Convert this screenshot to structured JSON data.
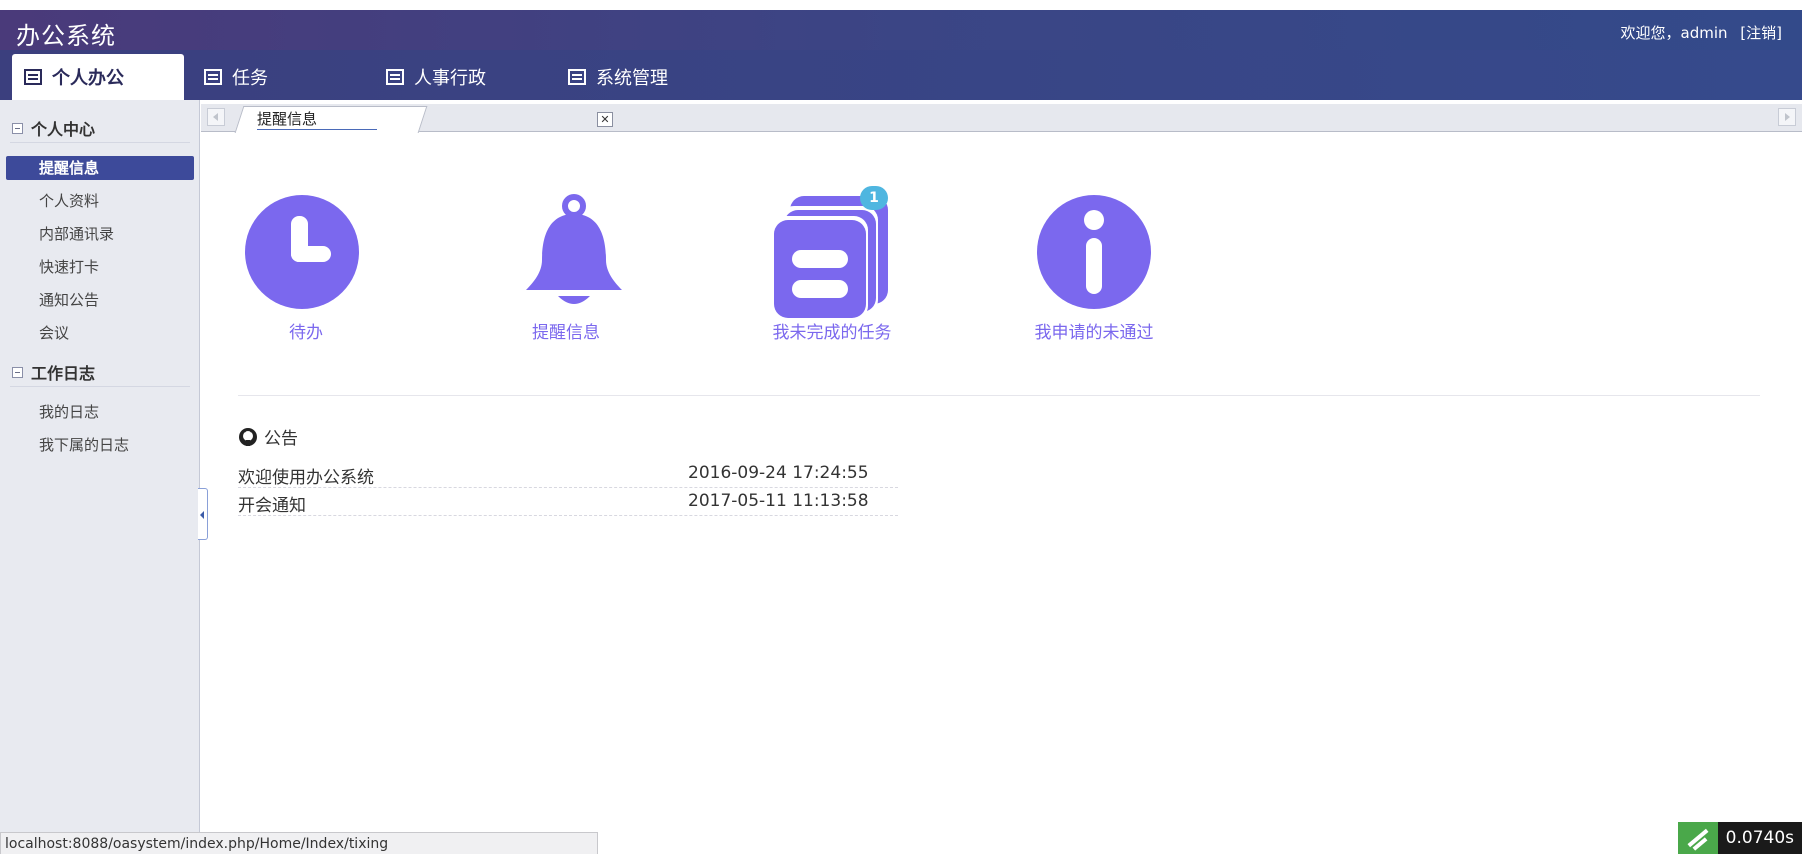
{
  "app": {
    "title": "办公系统",
    "welcome": "欢迎您，admin",
    "logout": "[注销]"
  },
  "nav": {
    "tabs": [
      {
        "label": "个人办公",
        "active": true
      },
      {
        "label": "任务"
      },
      {
        "label": "人事行政"
      },
      {
        "label": "系统管理"
      }
    ]
  },
  "sidebar": {
    "groups": [
      {
        "title": "个人中心",
        "items": [
          "提醒信息",
          "个人资料",
          "内部通讯录",
          "快速打卡",
          "通知公告",
          "会议"
        ]
      },
      {
        "title": "工作日志",
        "items": [
          "我的日志",
          "我下属的日志"
        ]
      }
    ],
    "active_item": "提醒信息"
  },
  "tabs": {
    "open_tab": "提醒信息"
  },
  "shortcuts": [
    {
      "label": "待办",
      "icon": "clock-icon"
    },
    {
      "label": "提醒信息",
      "icon": "bell-icon"
    },
    {
      "label": "我未完成的任务",
      "icon": "task-stack-icon",
      "badge": "1"
    },
    {
      "label": "我申请的未通过",
      "icon": "info-icon"
    }
  ],
  "notice": {
    "title": "公告",
    "items": [
      {
        "title": "欢迎使用办公系统",
        "time": "2016-09-24 17:24:55"
      },
      {
        "title": "开会通知",
        "time": "2017-05-11 11:13:58"
      }
    ]
  },
  "status": {
    "url": "localhost:8088/oasystem/index.php/Home/Index/tixing",
    "timer": "0.0740s"
  },
  "colors": {
    "accent": "#7b68ee",
    "nav_bg": "#3b4585",
    "sidebar_active": "#3d4a9a",
    "badge": "#4fb6e0"
  }
}
